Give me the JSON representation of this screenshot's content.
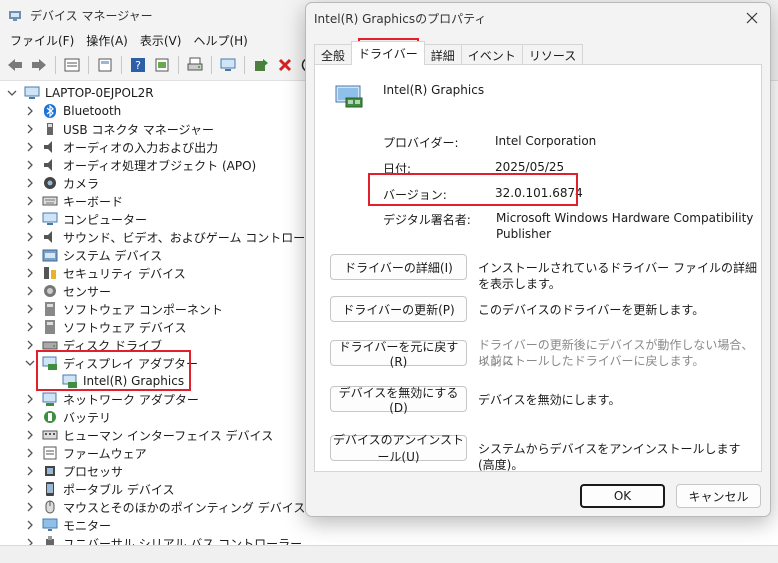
{
  "main_window": {
    "title": "デバイス マネージャー",
    "menu": [
      "ファイル(F)",
      "操作(A)",
      "表示(V)",
      "ヘルプ(H)"
    ],
    "toolbar_icons": [
      "back-icon",
      "forward-icon",
      "properties-icon",
      "window-icon",
      "help-icon",
      "details-icon",
      "print-icon",
      "computer-icon",
      "update-driver-icon",
      "uninstall-icon",
      "disable-icon"
    ]
  },
  "tree": {
    "root": "LAPTOP-0EJPOL2R",
    "items": [
      {
        "label": "Bluetooth",
        "icon": "bluetooth-icon",
        "expanded": false
      },
      {
        "label": "USB コネクタ マネージャー",
        "icon": "usb-connector-icon",
        "expanded": false
      },
      {
        "label": "オーディオの入力および出力",
        "icon": "audio-icon",
        "expanded": false
      },
      {
        "label": "オーディオ処理オブジェクト (APO)",
        "icon": "audio-icon",
        "expanded": false
      },
      {
        "label": "カメラ",
        "icon": "camera-icon",
        "expanded": false
      },
      {
        "label": "キーボード",
        "icon": "keyboard-icon",
        "expanded": false
      },
      {
        "label": "コンピューター",
        "icon": "computer-icon",
        "expanded": false
      },
      {
        "label": "サウンド、ビデオ、およびゲーム コントローラー",
        "icon": "audio-icon",
        "expanded": false
      },
      {
        "label": "システム デバイス",
        "icon": "system-folder-icon",
        "expanded": false
      },
      {
        "label": "セキュリティ デバイス",
        "icon": "security-icon",
        "expanded": false
      },
      {
        "label": "センサー",
        "icon": "sensor-icon",
        "expanded": false
      },
      {
        "label": "ソフトウェア コンポーネント",
        "icon": "component-icon",
        "expanded": false
      },
      {
        "label": "ソフトウェア デバイス",
        "icon": "component-icon",
        "expanded": false
      },
      {
        "label": "ディスク ドライブ",
        "icon": "disk-icon",
        "expanded": false
      },
      {
        "label": "ディスプレイ アダプター",
        "icon": "display-adapter-icon",
        "expanded": true
      },
      {
        "label": "Intel(R) Graphics",
        "icon": "display-adapter-icon",
        "child": true
      },
      {
        "label": "ネットワーク アダプター",
        "icon": "network-icon",
        "expanded": false
      },
      {
        "label": "バッテリ",
        "icon": "battery-icon",
        "expanded": false
      },
      {
        "label": "ヒューマン インターフェイス デバイス",
        "icon": "hid-icon",
        "expanded": false
      },
      {
        "label": "ファームウェア",
        "icon": "firmware-icon",
        "expanded": false
      },
      {
        "label": "プロセッサ",
        "icon": "processor-icon",
        "expanded": false
      },
      {
        "label": "ポータブル デバイス",
        "icon": "portable-icon",
        "expanded": false
      },
      {
        "label": "マウスとそのほかのポインティング デバイス",
        "icon": "mouse-icon",
        "expanded": false
      },
      {
        "label": "モニター",
        "icon": "monitor-icon",
        "expanded": false
      },
      {
        "label": "ユニバーサル シリアル バス コントローラー",
        "icon": "usb-icon",
        "expanded": false
      }
    ]
  },
  "dialog": {
    "title": "Intel(R) Graphicsのプロパティ",
    "tabs": [
      "全般",
      "ドライバー",
      "詳細",
      "イベント",
      "リソース"
    ],
    "active_tab": "ドライバー",
    "device_name": "Intel(R) Graphics",
    "fields": {
      "provider_label": "プロバイダー:",
      "provider_value": "Intel Corporation",
      "date_label": "日付:",
      "date_value": "2025/05/25",
      "version_label": "バージョン:",
      "version_value": "32.0.101.6874",
      "signer_label": "デジタル署名者:",
      "signer_value_line1": "Microsoft Windows Hardware Compatibility",
      "signer_value_line2": "Publisher"
    },
    "actions": [
      {
        "label": "ドライバーの詳細(I)",
        "desc": "インストールされているドライバー ファイルの詳細を表示します。",
        "enabled": true
      },
      {
        "label": "ドライバーの更新(P)",
        "desc": "このデバイスのドライバーを更新します。",
        "enabled": true
      },
      {
        "label": "ドライバーを元に戻す(R)",
        "desc_line1": "ドライバーの更新後にデバイスが動作しない場合、以前に",
        "desc_line2": "インストールしたドライバーに戻します。",
        "enabled": false
      },
      {
        "label": "デバイスを無効にする(D)",
        "desc": "デバイスを無効にします。",
        "enabled": true
      },
      {
        "label": "デバイスのアンインストール(U)",
        "desc": "システムからデバイスをアンインストールします (高度)。",
        "enabled": true
      }
    ],
    "ok_label": "OK",
    "cancel_label": "キャンセル"
  },
  "colors": {
    "highlight_red": "#e0212b",
    "accent_blue": "#0067c0"
  }
}
